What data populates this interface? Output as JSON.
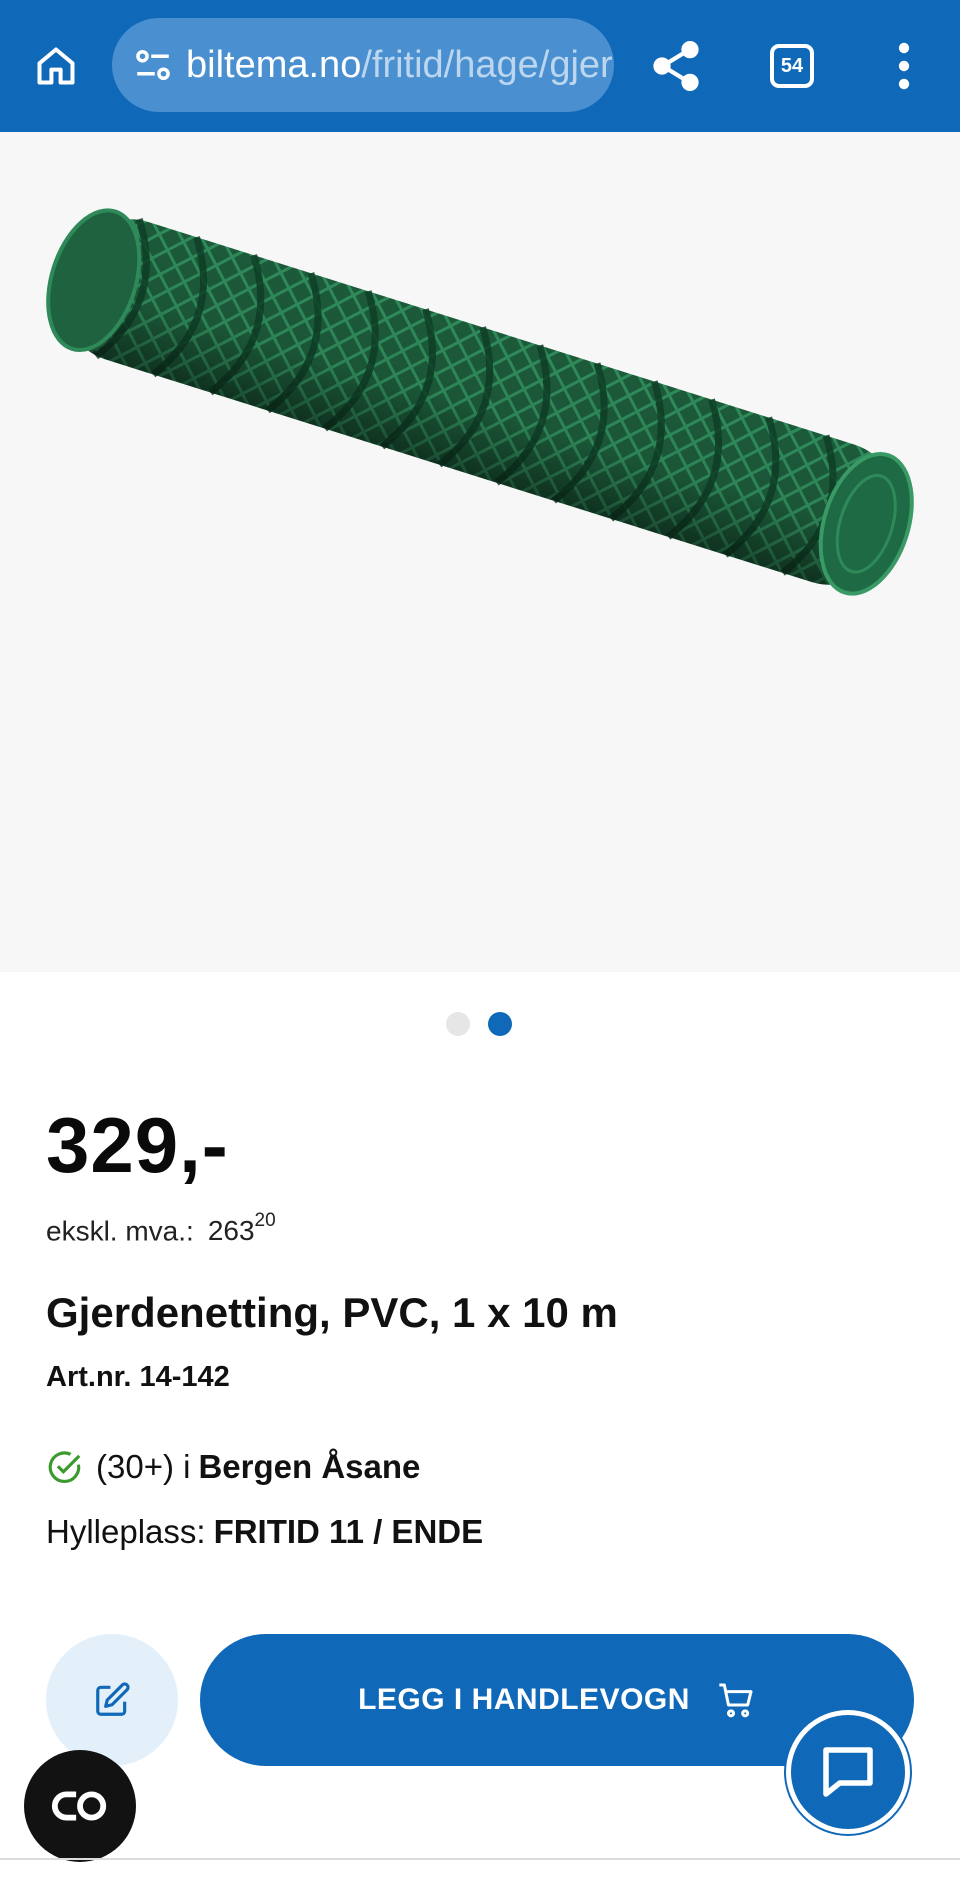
{
  "browser": {
    "url_domain": "biltema.no",
    "url_path": "/fritid/hage/gjerdenetting",
    "tab_count": "54",
    "home_icon": "home-icon",
    "site_settings_icon": "site-settings-icon",
    "share_icon": "share-icon",
    "menu_icon": "more-vert-icon",
    "bar_color": "#1068b8"
  },
  "product": {
    "image_alt": "Gjerdenetting rull",
    "carousel": {
      "total": 2,
      "active": 2
    },
    "price": "329,-",
    "ex_vat_label": "ekskl. mva.:",
    "ex_vat_whole": "263",
    "ex_vat_decimals": "20",
    "title": "Gjerdenetting, PVC, 1 x 10 m",
    "art_nr": "Art.nr. 14-142",
    "stock_count": "(30+) i",
    "stock_store": "Bergen Åsane",
    "shelf_label": "Hylleplass:",
    "shelf_value": "FRITID 11 / ENDE"
  },
  "actions": {
    "edit_icon": "edit-note-icon",
    "add_to_cart": "LEGG I HANDLEVOGN",
    "cart_icon": "cart-icon",
    "chat_icon": "chat-icon",
    "lens_icon": "lens-icon"
  },
  "colors": {
    "accent": "#1068b8",
    "in_stock": "#3a9a2e",
    "product_green": "#1f6b45"
  }
}
